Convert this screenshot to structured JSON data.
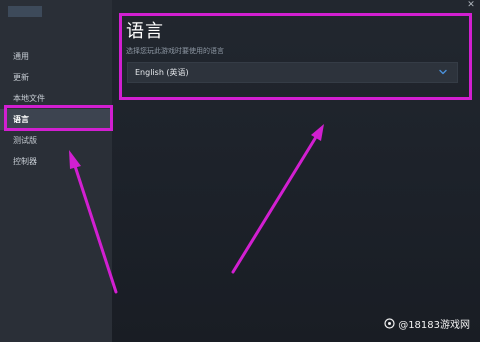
{
  "window": {
    "close_glyph": "✕"
  },
  "sidebar": {
    "items": [
      {
        "label": "通用",
        "active": false
      },
      {
        "label": "更新",
        "active": false
      },
      {
        "label": "本地文件",
        "active": false
      },
      {
        "label": "语言",
        "active": true
      },
      {
        "label": "测试版",
        "active": false
      },
      {
        "label": "控制器",
        "active": false
      }
    ]
  },
  "content": {
    "title": "语言",
    "description": "选择您玩此游戏时要使用的语言",
    "language_select": {
      "value": "English (英语)"
    }
  },
  "watermark": {
    "text": "@18183游戏网"
  },
  "colors": {
    "highlight": "#d21fd1",
    "chevron": "#4a90d9"
  }
}
